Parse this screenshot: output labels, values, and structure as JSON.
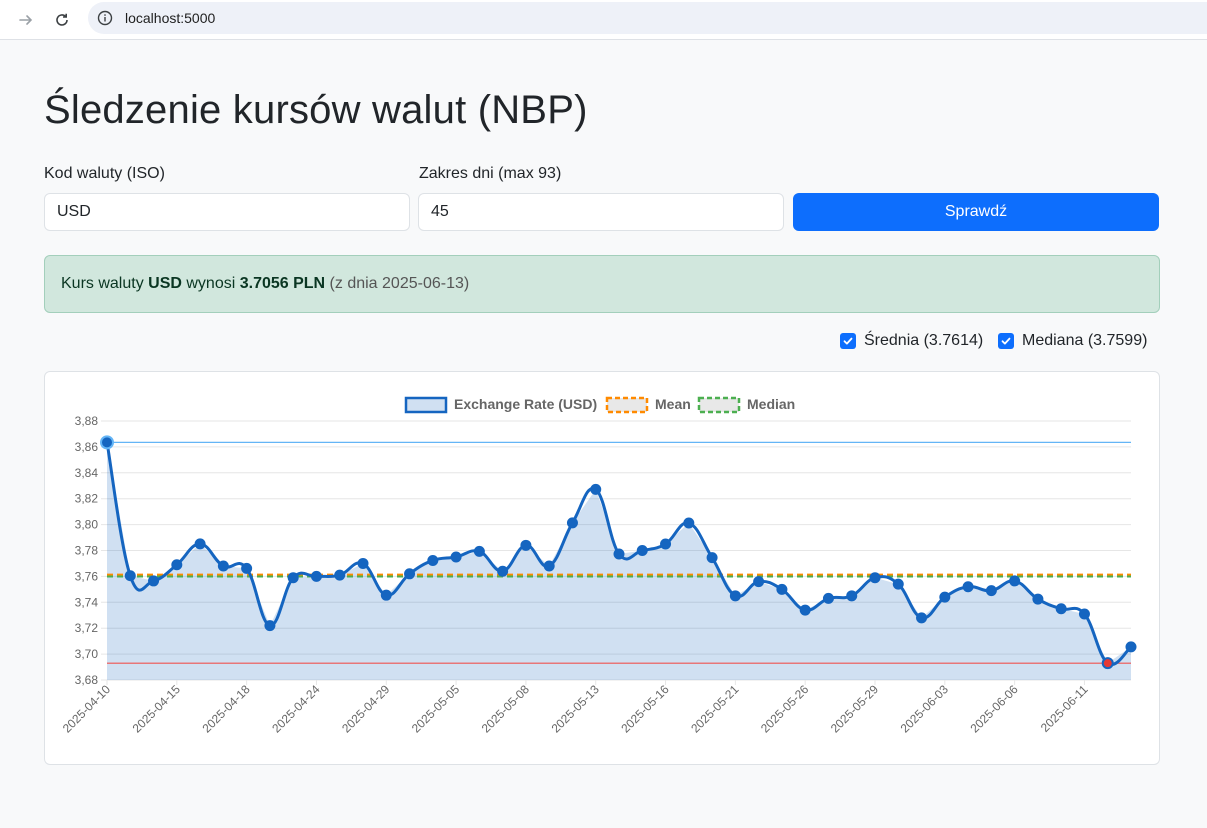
{
  "browser": {
    "url": "localhost:5000"
  },
  "page": {
    "title": "Śledzenie kursów walut (NBP)"
  },
  "form": {
    "currency_label": "Kod waluty (ISO)",
    "currency_value": "USD",
    "days_label": "Zakres dni (max 93)",
    "days_value": "45",
    "submit_label": "Sprawdź"
  },
  "result": {
    "prefix": "Kurs waluty ",
    "currency": "USD",
    "middle": " wynosi ",
    "rate": "3.7056 PLN",
    "date_text": " (z dnia 2025-06-13)"
  },
  "toggles": {
    "mean_label": "Średnia (3.7614)",
    "median_label": "Mediana (3.7599)"
  },
  "colors": {
    "primary": "#0d6efd",
    "line": "#1565c0",
    "fill": "rgba(21,101,192,0.2)",
    "mean": "#ff8a00",
    "median": "#4caf50",
    "max_line": "#64b5f6",
    "min_line": "#ef5350"
  },
  "chart_data": {
    "type": "line",
    "legend": [
      "Exchange Rate (USD)",
      "Mean",
      "Median"
    ],
    "legend_position": "top",
    "x": [
      "2025-04-10",
      "2025-04-11",
      "2025-04-14",
      "2025-04-15",
      "2025-04-16",
      "2025-04-17",
      "2025-04-18",
      "2025-04-22",
      "2025-04-23",
      "2025-04-24",
      "2025-04-25",
      "2025-04-28",
      "2025-04-29",
      "2025-04-30",
      "2025-05-02",
      "2025-05-05",
      "2025-05-06",
      "2025-05-07",
      "2025-05-08",
      "2025-05-09",
      "2025-05-12",
      "2025-05-13",
      "2025-05-14",
      "2025-05-15",
      "2025-05-16",
      "2025-05-19",
      "2025-05-20",
      "2025-05-21",
      "2025-05-22",
      "2025-05-23",
      "2025-05-26",
      "2025-05-27",
      "2025-05-28",
      "2025-05-29",
      "2025-05-30",
      "2025-06-02",
      "2025-06-03",
      "2025-06-04",
      "2025-06-05",
      "2025-06-06",
      "2025-06-09",
      "2025-06-10",
      "2025-06-11",
      "2025-06-12",
      "2025-06-13"
    ],
    "tick_labels": [
      "2025-04-10",
      "2025-04-15",
      "2025-04-18",
      "2025-04-24",
      "2025-04-29",
      "2025-05-05",
      "2025-05-08",
      "2025-05-13",
      "2025-05-16",
      "2025-05-21",
      "2025-05-26",
      "2025-05-29",
      "2025-06-03",
      "2025-06-06",
      "2025-06-11"
    ],
    "series": [
      {
        "name": "Exchange Rate (USD)",
        "values": [
          3.8635,
          3.7605,
          3.7565,
          3.769,
          3.7851,
          3.768,
          3.7662,
          3.722,
          3.759,
          3.76,
          3.761,
          3.77,
          3.7455,
          3.762,
          3.7723,
          3.775,
          3.7793,
          3.764,
          3.784,
          3.768,
          3.8013,
          3.8272,
          3.7773,
          3.78,
          3.785,
          3.8012,
          3.7745,
          3.745,
          3.756,
          3.75,
          3.734,
          3.743,
          3.745,
          3.759,
          3.754,
          3.728,
          3.744,
          3.752,
          3.749,
          3.7565,
          3.7425,
          3.735,
          3.731,
          3.693,
          3.7056
        ]
      }
    ],
    "mean": 3.7614,
    "median": 3.7599,
    "max": 3.8635,
    "min": 3.693,
    "ylim": [
      3.68,
      3.88
    ],
    "y_ticks": [
      "3,88",
      "3,86",
      "3,84",
      "3,82",
      "3,80",
      "3,78",
      "3,76",
      "3,74",
      "3,72",
      "3,70",
      "3,68"
    ],
    "grid": true
  }
}
